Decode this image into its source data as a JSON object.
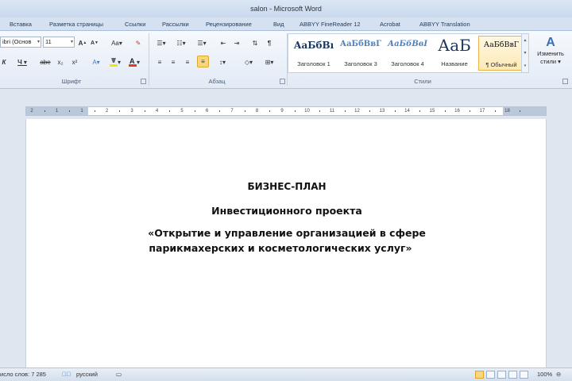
{
  "window": {
    "title": "salon  -  Microsoft Word"
  },
  "tabs": [
    {
      "label": "Вставка"
    },
    {
      "label": "Разметка страницы"
    },
    {
      "label": "Ссылки"
    },
    {
      "label": "Рассылки"
    },
    {
      "label": "Рецензирование"
    },
    {
      "label": "Вид"
    },
    {
      "label": "ABBYY FineReader 12"
    },
    {
      "label": "Acrobat"
    },
    {
      "label": "ABBYY Translation"
    }
  ],
  "font_group": {
    "font_name": "ibri (Основ",
    "font_size": "11",
    "label": "Шрифт",
    "font_color": "#e03a2c",
    "highlight_color": "#f5e400"
  },
  "paragraph_group": {
    "label": "Абзац"
  },
  "styles_group": {
    "label": "Стили",
    "items": [
      {
        "sample": "АаБбВı",
        "name": "Заголовок 1"
      },
      {
        "sample": "АаБбВвГ",
        "name": "Заголовок 3"
      },
      {
        "sample": "АаБбВвI",
        "name": "Заголовок 4"
      },
      {
        "sample": "АаБ",
        "name": "Название"
      },
      {
        "sample": "АаБбВвГ",
        "name": "¶ Обычный"
      }
    ],
    "change_styles": {
      "line1": "Изменить",
      "line2": "стили"
    }
  },
  "ruler": {
    "numbers": [
      "2",
      "1",
      "1",
      "2",
      "3",
      "4",
      "5",
      "6",
      "7",
      "8",
      "9",
      "10",
      "11",
      "12",
      "13",
      "14",
      "15",
      "16",
      "17",
      "18"
    ]
  },
  "document": {
    "lines": [
      "БИЗНЕС-ПЛАН",
      "Инвестиционного проекта",
      "«Открытие и управление организацией в сфере",
      "парикмахерских и косметологических услуг»"
    ]
  },
  "statusbar": {
    "word_count": "исло слов: 7 285",
    "language": "русский",
    "zoom": "100%"
  }
}
